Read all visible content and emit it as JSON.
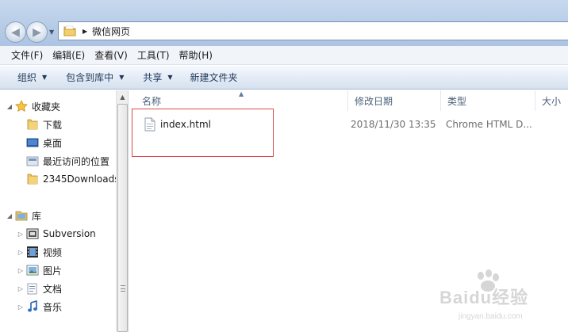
{
  "address": {
    "path": "微信网页"
  },
  "menu": [
    "文件(F)",
    "编辑(E)",
    "查看(V)",
    "工具(T)",
    "帮助(H)"
  ],
  "toolbar": {
    "organize": "组织",
    "include_library": "包含到库中",
    "share": "共享",
    "new_folder": "新建文件夹"
  },
  "nav": {
    "favorites": "收藏夹",
    "downloads": "下载",
    "desktop": "桌面",
    "recent": "最近访问的位置",
    "downloads2345": "2345Downloads",
    "libraries": "库",
    "subversion": "Subversion",
    "videos": "视频",
    "pictures": "图片",
    "documents": "文档",
    "music": "音乐"
  },
  "columns": {
    "name": "名称",
    "modified": "修改日期",
    "type": "类型",
    "size": "大小"
  },
  "files": [
    {
      "name": "index.html",
      "modified": "2018/11/30 13:35",
      "type": "Chrome HTML D..."
    }
  ],
  "watermark": {
    "brand": "Baidu经验",
    "url": "jingyan.baidu.com"
  },
  "colors": {
    "highlight": "#d94a4a",
    "accent": "#1e395b"
  }
}
